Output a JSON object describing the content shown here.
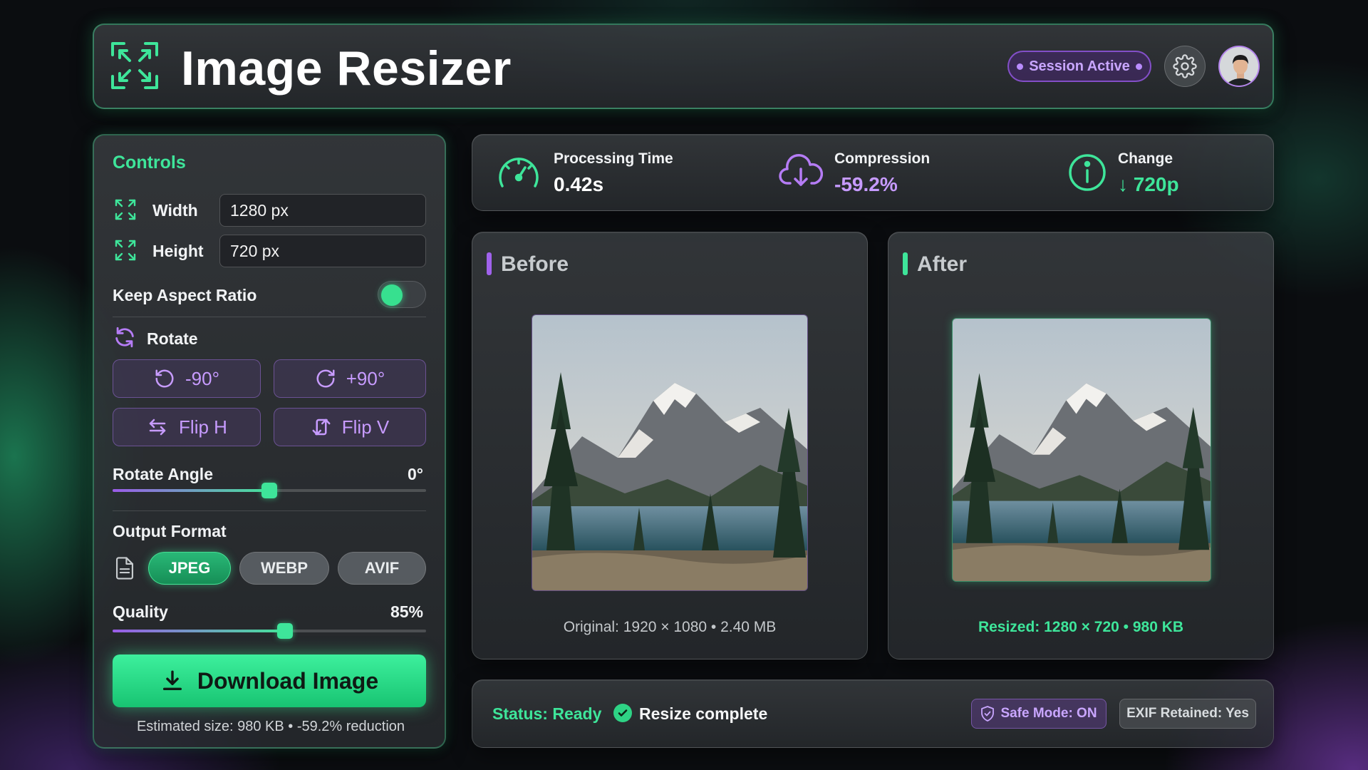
{
  "header": {
    "title": "Image Resizer",
    "session_label": "Session Active"
  },
  "controls": {
    "title": "Controls",
    "width_label": "Width",
    "width_value": "1280 px",
    "height_label": "Height",
    "height_value": "720 px",
    "aspect_label": "Keep Aspect Ratio",
    "aspect_on": true,
    "rotate_label": "Rotate",
    "rotate_left": "-90°",
    "rotate_right": "+90°",
    "flip_h": "Flip H",
    "flip_v": "Flip V",
    "rotate_angle_label": "Rotate Angle",
    "rotate_angle_value": "0°",
    "rotate_angle_fraction": 0.5,
    "output_format_label": "Output Format",
    "formats": [
      "JPEG",
      "WEBP",
      "AVIF"
    ],
    "selected_format": "JPEG",
    "quality_label": "Quality",
    "quality_value": "85%",
    "quality_fraction": 0.55,
    "download_label": "Download Image",
    "estimate_text": "Estimated size: 980 KB • -59.2% reduction"
  },
  "stats": {
    "processing_label": "Processing Time",
    "processing_value": "0.42s",
    "compression_label": "Compression",
    "compression_value": "-59.2%",
    "change_label": "Change",
    "change_value": "↓ 720p"
  },
  "before": {
    "title": "Before",
    "caption": "Original: 1920 × 1080 • 2.40 MB"
  },
  "after": {
    "title": "After",
    "caption": "Resized: 1280 × 720 • 980 KB"
  },
  "status": {
    "ready": "Status: Ready",
    "message": "Resize complete",
    "safe_mode": "Safe Mode: ON",
    "exif": "EXIF Retained: Yes"
  },
  "colors": {
    "accent_green": "#3ee59a",
    "accent_purple": "#c79bff",
    "background": "#0b0d10"
  }
}
